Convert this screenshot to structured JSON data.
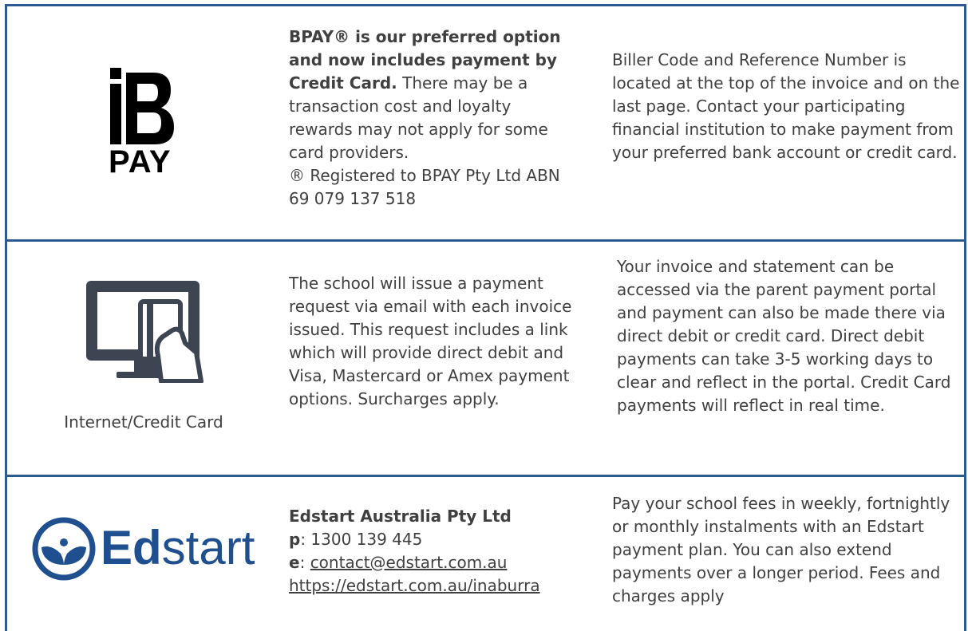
{
  "rows": [
    {
      "logo": "bpay-logo",
      "logo_text": "PAY",
      "col2_bold": "BPAY® is our preferred option and now includes payment by Credit Card.",
      "col2_text": " There may be a transaction cost and loyalty rewards may not apply for some card providers.",
      "col2_note": "® Registered to BPAY Pty Ltd ABN 69 079 137 518",
      "col3_text": "Biller Code and Reference Number is located at the top of the invoice and on the last page. Contact your participating financial institution to make payment from your preferred bank account or credit card."
    },
    {
      "logo": "monitor-card-icon",
      "caption": "Internet/Credit Card",
      "col2_text": "The school will issue a payment request via email with each invoice issued. This request includes a link which will provide direct debit and Visa, Mastercard or Amex payment options. Surcharges apply.",
      "col3_text": "Your invoice and statement can be accessed via the parent payment portal and payment can also be made there via direct debit or credit card. Direct debit payments can take 3-5 working days to clear and reflect in the portal. Credit Card payments will reflect in real time."
    },
    {
      "logo": "edstart-logo",
      "logo_text_bold": "Ed",
      "logo_text_light": "start",
      "company": "Edstart Australia Pty Ltd",
      "phone_label": "p",
      "phone": ": 1300 139 445",
      "email_label": "e",
      "email_sep": ": ",
      "email": "contact@edstart.com.au",
      "url": "https://edstart.com.au/inaburra",
      "col3_text": "Pay your school fees in weekly, fortnightly or monthly instalments with an Edstart payment plan. You can also extend payments over a longer period. Fees and charges apply"
    }
  ],
  "colors": {
    "border": "#2e5a94",
    "edstart_blue": "#1f4f8f",
    "icon": "#3d4452"
  }
}
